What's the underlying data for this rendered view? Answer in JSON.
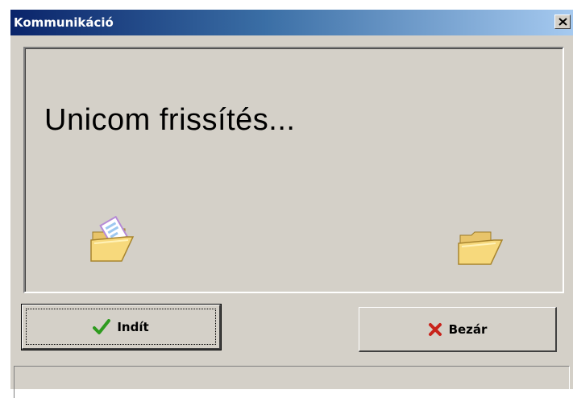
{
  "window": {
    "title": "Kommunikáció",
    "close_icon": "close-x-icon"
  },
  "panel": {
    "headline": "Unicom frissítés...",
    "left_icon": "open-folder-with-document-icon",
    "right_icon": "open-folder-icon"
  },
  "buttons": {
    "start_label": "Indít",
    "start_icon": "checkmark-icon",
    "close_label": "Bezár",
    "close_icon": "red-x-icon"
  },
  "colors": {
    "title_gradient_start": "#0a246a",
    "title_gradient_end": "#a6caf0",
    "face": "#d4d0c8",
    "check_green": "#2e9b1f",
    "x_red": "#c8231b"
  },
  "statusbar": {
    "text": ""
  }
}
